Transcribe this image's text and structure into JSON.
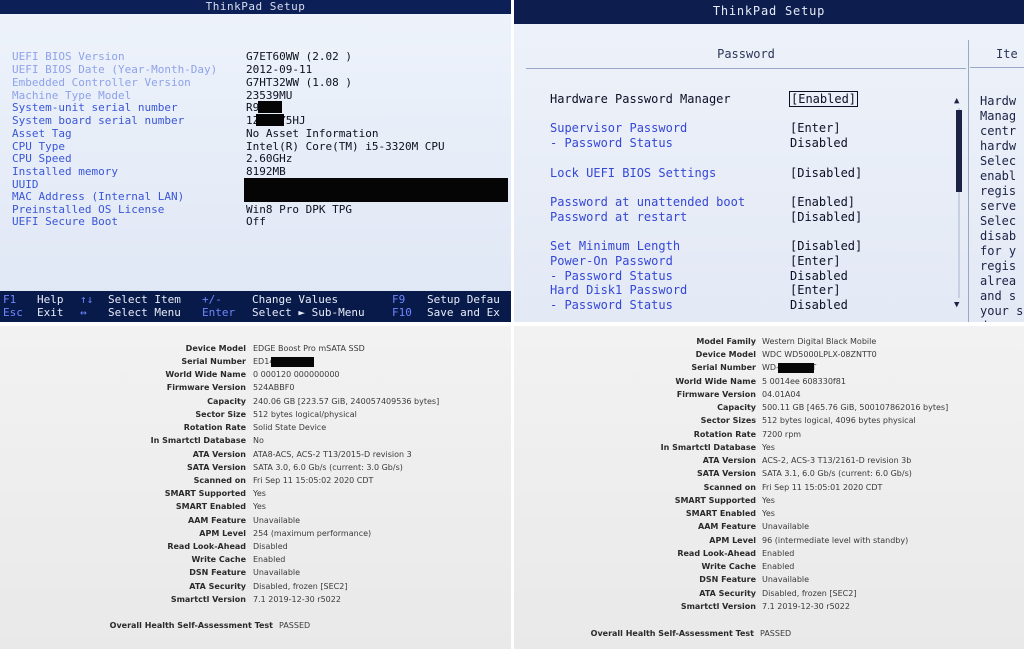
{
  "bios_main": {
    "title": "ThinkPad Setup",
    "rows": [
      {
        "label": "UEFI BIOS Version",
        "value": "G7ET60WW (2.02 )",
        "faint": true
      },
      {
        "label": "UEFI BIOS Date (Year-Month-Day)",
        "value": "2012-09-11",
        "faint": true
      },
      {
        "label": "Embedded Controller Version",
        "value": "G7HT32WW (1.08 )",
        "faint": true
      },
      {
        "label": "Machine Type Model",
        "value": "23539MU",
        "faint": true
      },
      {
        "label": "System-unit serial number",
        "value": "R9      CG",
        "faint": false
      },
      {
        "label": "System board serial number",
        "value": "1Z      2AY5HJ",
        "faint": false
      },
      {
        "label": "Asset Tag",
        "value": "No Asset Information",
        "faint": false
      },
      {
        "label": "CPU Type",
        "value": "Intel(R) Core(TM) i5-3320M CPU",
        "faint": false
      },
      {
        "label": "CPU Speed",
        "value": "2.60GHz",
        "faint": false
      },
      {
        "label": "Installed memory",
        "value": "8192MB",
        "faint": false
      },
      {
        "label": "UUID",
        "value": "",
        "faint": false
      },
      {
        "label": "MAC Address (Internal LAN)",
        "value": "",
        "faint": false
      },
      {
        "label": "Preinstalled OS License",
        "value": "Win8 Pro DPK TPG",
        "faint": false
      },
      {
        "label": "UEFI Secure Boot",
        "value": "Off",
        "faint": false
      }
    ],
    "help": {
      "f1": "F1",
      "help": "Help",
      "esc": "Esc",
      "exit": "Exit",
      "updown": "↑↓",
      "select_item": "Select Item",
      "leftright": "↔",
      "select_menu": "Select Menu",
      "plusminus": "+/-",
      "change_values": "Change Values",
      "enter": "Enter",
      "select_sub": "Select ► Sub-Menu",
      "f9": "F9",
      "setup_defaults": "Setup Defau",
      "f10": "F10",
      "save_exit": "Save and Ex"
    }
  },
  "bios_password": {
    "title": "ThinkPad Setup",
    "section": "Password",
    "side_section": "Ite",
    "rows": [
      {
        "label": "Hardware Password Manager",
        "value": "[Enabled]",
        "selected": true
      },
      {
        "label": "Supervisor Password",
        "value": "[Enter]",
        "selected": false
      },
      {
        "label": " - Password Status",
        "value": "Disabled",
        "selected": false
      },
      {
        "label": "Lock UEFI BIOS Settings",
        "value": "[Disabled]",
        "selected": false
      },
      {
        "label": "Password at unattended boot",
        "value": "[Enabled]",
        "selected": false
      },
      {
        "label": "Password at restart",
        "value": "[Disabled]",
        "selected": false
      },
      {
        "label": "Set Minimum Length",
        "value": "[Disabled]",
        "selected": false
      },
      {
        "label": "Power-On Password",
        "value": "[Enter]",
        "selected": false
      },
      {
        "label": " - Password Status",
        "value": "Disabled",
        "selected": false
      },
      {
        "label": "Hard Disk1 Password",
        "value": "[Enter]",
        "selected": false
      },
      {
        "label": " - Password Status",
        "value": "Disabled",
        "selected": false
      }
    ],
    "help_lines": [
      "Hardw",
      "Manag",
      "centr",
      "hardw",
      "Selec",
      "enabl",
      "regis",
      "serve",
      "Selec",
      "disab",
      "for y",
      "regis",
      "alrea",
      "and s",
      "your s",
      "dereg"
    ]
  },
  "disk1": {
    "rows": [
      {
        "k": "Device Model",
        "v": "EDGE Boost Pro mSATA SSD"
      },
      {
        "k": "Serial Number",
        "v": "ED14             0302"
      },
      {
        "k": "World Wide Name",
        "v": "0 000120 000000000"
      },
      {
        "k": "Firmware Version",
        "v": "524ABBF0"
      },
      {
        "k": "Capacity",
        "v": "240.06 GB [223.57 GiB, 240057409536 bytes]"
      },
      {
        "k": "Sector Size",
        "v": "512 bytes logical/physical"
      },
      {
        "k": "Rotation Rate",
        "v": "Solid State Device"
      },
      {
        "k": "In Smartctl Database",
        "v": "No"
      },
      {
        "k": "ATA Version",
        "v": "ATA8-ACS, ACS-2 T13/2015-D revision 3"
      },
      {
        "k": "SATA Version",
        "v": "SATA 3.0, 6.0 Gb/s (current: 3.0 Gb/s)"
      },
      {
        "k": "Scanned on",
        "v": "Fri Sep 11 15:05:02 2020 CDT"
      },
      {
        "k": "SMART Supported",
        "v": "Yes"
      },
      {
        "k": "SMART Enabled",
        "v": "Yes"
      },
      {
        "k": "AAM Feature",
        "v": "Unavailable"
      },
      {
        "k": "APM Level",
        "v": "254 (maximum performance)"
      },
      {
        "k": "Read Look-Ahead",
        "v": "Disabled"
      },
      {
        "k": "Write Cache",
        "v": "Enabled"
      },
      {
        "k": "DSN Feature",
        "v": "Unavailable"
      },
      {
        "k": "ATA Security",
        "v": "Disabled, frozen [SEC2]"
      },
      {
        "k": "Smartctl Version",
        "v": "7.1 2019-12-30 r5022"
      }
    ],
    "health_label": "Overall Health Self-Assessment Test",
    "health_value": "PASSED"
  },
  "disk2": {
    "rows": [
      {
        "k": "Model Family",
        "v": "Western Digital Black Mobile"
      },
      {
        "k": "Device Model",
        "v": "WDC WD5000LPLX-08ZNTT0"
      },
      {
        "k": "Serial Number",
        "v": "WD-WX          NNYT"
      },
      {
        "k": "World Wide Name",
        "v": "5 0014ee 608330f81"
      },
      {
        "k": "Firmware Version",
        "v": "04.01A04"
      },
      {
        "k": "Capacity",
        "v": "500.11 GB [465.76 GiB, 500107862016 bytes]"
      },
      {
        "k": "Sector Sizes",
        "v": "512 bytes logical, 4096 bytes physical"
      },
      {
        "k": "Rotation Rate",
        "v": "7200 rpm"
      },
      {
        "k": "In Smartctl Database",
        "v": "Yes"
      },
      {
        "k": "ATA Version",
        "v": "ACS-2, ACS-3 T13/2161-D revision 3b"
      },
      {
        "k": "SATA Version",
        "v": "SATA 3.1, 6.0 Gb/s (current: 6.0 Gb/s)"
      },
      {
        "k": "Scanned on",
        "v": "Fri Sep 11 15:05:01 2020 CDT"
      },
      {
        "k": "SMART Supported",
        "v": "Yes"
      },
      {
        "k": "SMART Enabled",
        "v": "Yes"
      },
      {
        "k": "AAM Feature",
        "v": "Unavailable"
      },
      {
        "k": "APM Level",
        "v": "96 (intermediate level with standby)"
      },
      {
        "k": "Read Look-Ahead",
        "v": "Enabled"
      },
      {
        "k": "Write Cache",
        "v": "Enabled"
      },
      {
        "k": "DSN Feature",
        "v": "Unavailable"
      },
      {
        "k": "ATA Security",
        "v": "Disabled, frozen [SEC2]"
      },
      {
        "k": "Smartctl Version",
        "v": "7.1 2019-12-30 r5022"
      }
    ],
    "health_label": "Overall Health Self-Assessment Test",
    "health_value": "PASSED"
  }
}
